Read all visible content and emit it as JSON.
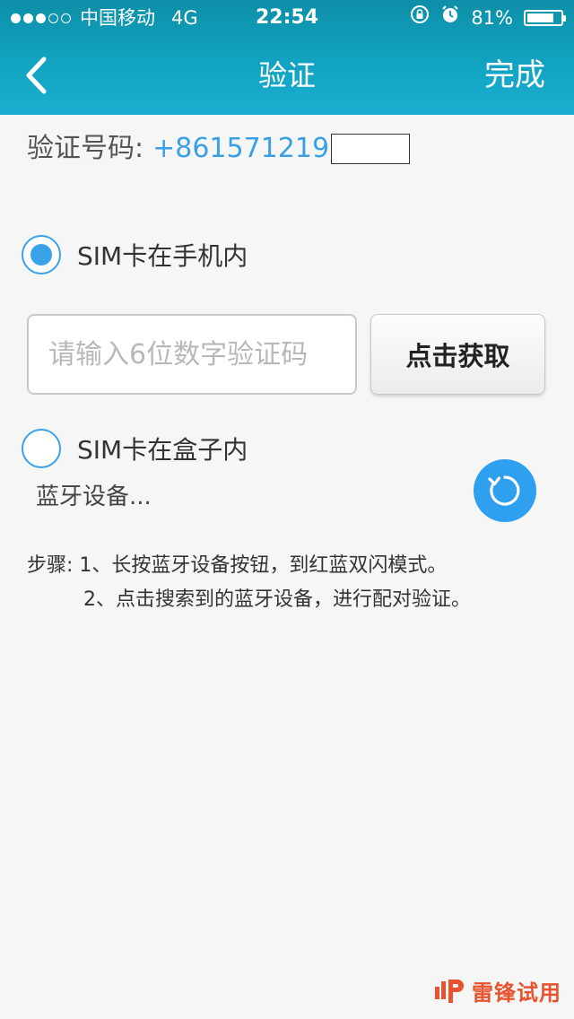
{
  "status_bar": {
    "signal_full": 3,
    "signal_empty": 2,
    "carrier": "中国移动",
    "network": "4G",
    "time": "22:54",
    "battery_percent": "81%",
    "battery_level": 0.81
  },
  "navbar": {
    "title": "验证",
    "done_label": "完成",
    "back_icon": "chevron-left-icon"
  },
  "phone": {
    "label": "验证号码:",
    "number": "+861571219"
  },
  "option_phone": {
    "label": "SIM卡在手机内",
    "selected": true
  },
  "code_input": {
    "value": "",
    "placeholder": "请输入6位数字验证码"
  },
  "get_code_button": {
    "label": "点击获取"
  },
  "option_box": {
    "label": "SIM卡在盒子内",
    "selected": false
  },
  "bluetooth": {
    "status_text": "蓝牙设备...",
    "refresh_icon": "refresh-icon"
  },
  "steps": {
    "line1": "步骤: 1、长按蓝牙设备按钮，到红蓝双闪模式。",
    "line2": "2、点击搜索到的蓝牙设备，进行配对验证。"
  },
  "watermark": {
    "text": "雷锋试用"
  },
  "colors": {
    "header": "#12a3c2",
    "accent": "#3aa3e8",
    "watermark": "#e8532f"
  }
}
